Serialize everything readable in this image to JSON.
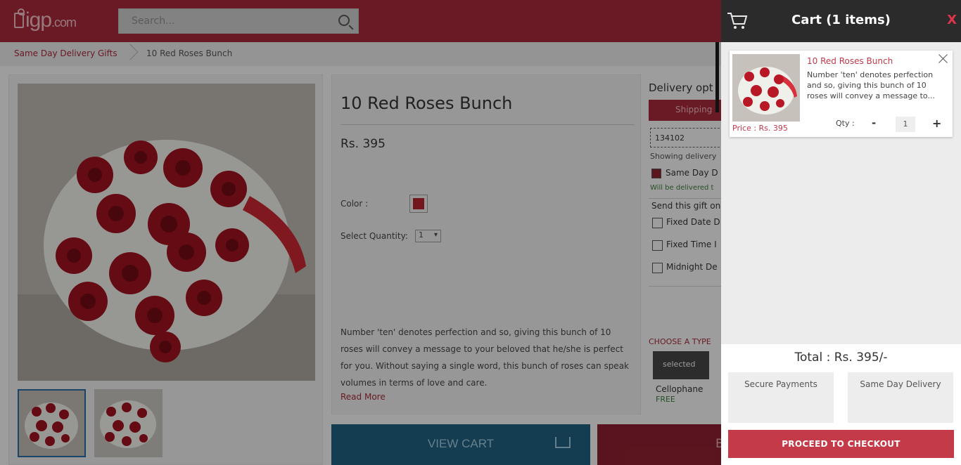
{
  "header": {
    "logo_text": "igp",
    "logo_suffix": ".com",
    "search_placeholder": "Search..."
  },
  "breadcrumb": {
    "items": [
      "Same Day Delivery Gifts",
      "10 Red Roses Bunch"
    ]
  },
  "product": {
    "title": "10 Red Roses Bunch",
    "price": "Rs. 395",
    "color_label": "Color :",
    "quantity_label": "Select Quantity:",
    "quantity_value": "1",
    "description": "Number 'ten' denotes perfection and so, giving this bunch of 10 roses will convey a message to your beloved that he/she is perfect for you. Without saying a single word, this bunch of roses can speak volumes in terms of love and care.",
    "read_more": "Read More"
  },
  "delivery": {
    "heading": "Delivery opt",
    "shipping_label": "Shipping",
    "pincode": "134102",
    "showing_text": "Showing delivery",
    "same_day_label": "Same Day D",
    "delivered_note": "Will be delivered t",
    "send_label": "Send this gift on",
    "options": [
      "Fixed Date D",
      "Fixed Time I",
      "Midnight De"
    ],
    "choose_type": "CHOOSE A TYPE",
    "type_selected": "selected",
    "type_name": "Cellophane",
    "type_price": "FREE"
  },
  "actions": {
    "view_cart": "VIEW CART",
    "buy_now": "B"
  },
  "cart": {
    "title": "Cart (1 items)",
    "close": "X",
    "item": {
      "name": "10 Red Roses Bunch",
      "description": "Number 'ten' denotes perfection and so, giving this bunch of 10 roses will convey a message to...",
      "price": "Price : Rs. 395",
      "qty_label": "Qty :",
      "qty_minus": "-",
      "qty_value": "1",
      "qty_plus": "+"
    },
    "total": "Total : Rs. 395/-",
    "badges": [
      "Secure Payments",
      "Same Day Delivery"
    ],
    "checkout": "PROCEED TO CHECKOUT"
  },
  "colors": {
    "brand": "#a3283a",
    "checkout": "#c43a49",
    "view_cart": "#1f5f7d",
    "cart_header": "#2b2b2b",
    "swatch": "#b3232f"
  },
  "icons": [
    "gift-icon",
    "search-icon",
    "cart-icon",
    "close-icon",
    "remove-item-icon"
  ]
}
